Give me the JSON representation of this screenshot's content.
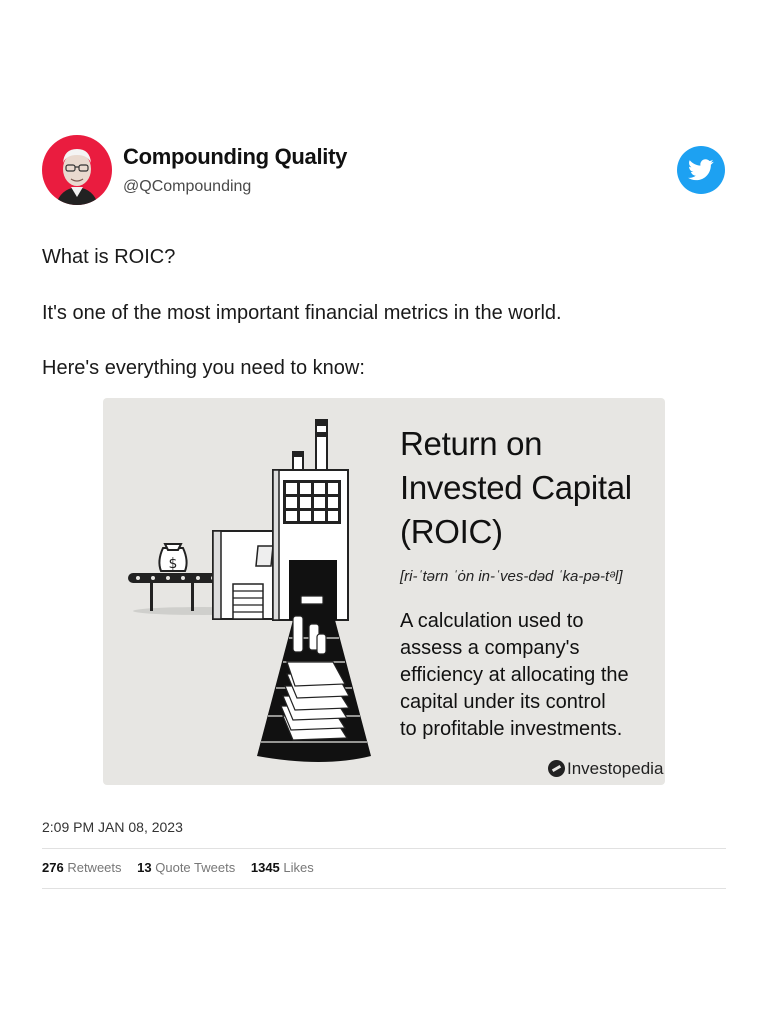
{
  "author": {
    "name": "Compounding Quality",
    "handle": "@QCompounding"
  },
  "tweet": {
    "lines": [
      "What is ROIC?",
      "It's one of the most important financial metrics in the world.",
      "Here's everything you need to know:"
    ],
    "timestamp": "2:09 PM JAN 08, 2023"
  },
  "card": {
    "title_lines": [
      "Return on",
      "Invested Capital",
      "(ROIC)"
    ],
    "pronunciation": "[ri-ˈtərn ˈȯn in-ˈves-dəd ˈka-pə-tᵊl]",
    "description_lines": [
      "A calculation used to",
      "assess a company's",
      "efficiency at allocating the",
      "capital under its control",
      "to profitable investments."
    ],
    "brand": "Investopedia",
    "illustration_icons": [
      "factory-icon",
      "money-bag-icon",
      "conveyor-belt-icon",
      "cash-stack-icon",
      "coin-stack-icon"
    ]
  },
  "stats": {
    "retweets": "276",
    "retweets_label": "Retweets",
    "quote_tweets": "13",
    "quote_tweets_label": "Quote Tweets",
    "likes": "1345",
    "likes_label": "Likes"
  },
  "colors": {
    "avatar_bg": "#ea1c3f",
    "twitter_blue": "#1da1f2",
    "card_bg": "#e7e6e3"
  }
}
